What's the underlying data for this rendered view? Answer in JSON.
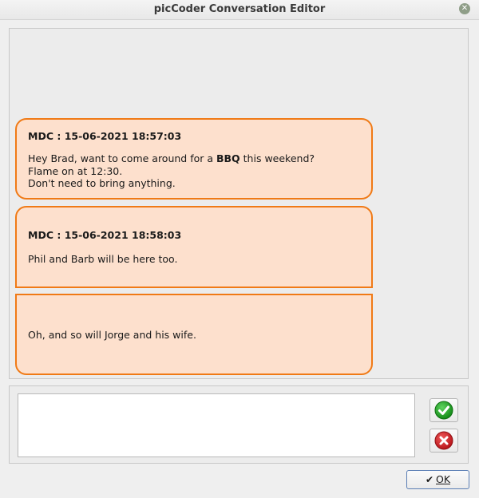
{
  "window": {
    "title": "picCoder Conversation Editor",
    "close_glyph": "✕"
  },
  "messages": [
    {
      "header": "MDC : 15-06-2021 18:57:03",
      "line1_before": "Hey Brad, want to come around for a ",
      "line1_bold": "BBQ",
      "line1_after": " this weekend?",
      "line2": "Flame on at 12:30.",
      "line3": "Don't need to bring anything."
    },
    {
      "header": "MDC : 15-06-2021 18:58:03",
      "line1": "Phil and Barb will be here too."
    },
    {
      "line1": "Oh, and so will Jorge and his wife."
    }
  ],
  "input": {
    "value": ""
  },
  "buttons": {
    "ok_label": "OK",
    "ok_icon": "checkmark-icon",
    "accept_icon": "green-check-icon",
    "cancel_icon": "red-x-icon"
  },
  "colors": {
    "bubble_fill": "#fde0cd",
    "bubble_border": "#f07a16",
    "accept": "#1fa323",
    "cancel": "#d81b22"
  }
}
